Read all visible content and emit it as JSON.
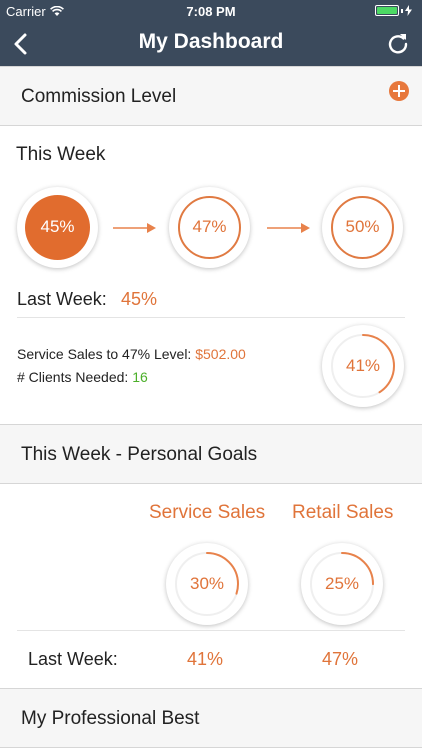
{
  "status_bar": {
    "carrier": "Carrier",
    "time": "7:08 PM"
  },
  "nav": {
    "title": "My Dashboard",
    "back_icon": "chevron-left-icon",
    "refresh_icon": "refresh-icon"
  },
  "commission": {
    "header": "Commission Level",
    "add_icon": "plus-circle-icon",
    "this_week_label": "This Week",
    "levels": [
      {
        "value": "45%",
        "percent": 45
      },
      {
        "value": "47%",
        "percent": 47
      },
      {
        "value": "50%",
        "percent": 50
      }
    ],
    "last_week_label": "Last Week:",
    "last_week_value": "45%",
    "service_sales_label": "Service Sales to 47% Level:",
    "service_sales_value": "$502.00",
    "clients_label": "# Clients Needed:",
    "clients_value": "16",
    "progress_value": "41%",
    "progress_percent": 41
  },
  "personal_goals": {
    "header": "This Week - Personal Goals",
    "service_label": "Service Sales",
    "retail_label": "Retail Sales",
    "service_value": "30%",
    "service_percent": 30,
    "retail_value": "25%",
    "retail_percent": 25,
    "last_week_label": "Last Week:",
    "service_last_week": "41%",
    "retail_last_week": "47%"
  },
  "professional_best": {
    "header": "My Professional Best"
  },
  "colors": {
    "nav_bg": "#3b4a5c",
    "accent": "#e0743a",
    "green": "#4caf2a",
    "battery": "#4cd964"
  }
}
